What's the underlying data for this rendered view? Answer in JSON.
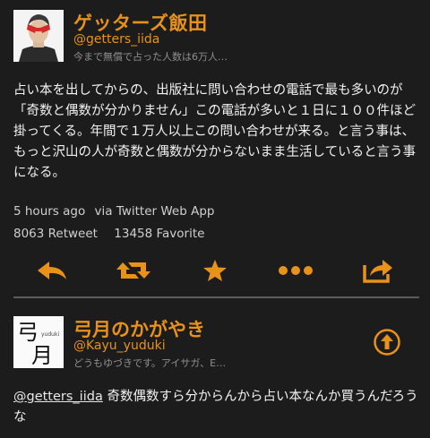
{
  "main_tweet": {
    "display_name": "ゲッターズ飯田",
    "handle": "@getters_iida",
    "bio_snippet": "今まで無償で占った人数は6万人…",
    "text": "占い本を出してからの、出版社に問い合わせの電話で最も多いのが「奇数と偶数が分かりません」この電話が多いと１日に１００件ほど掛ってくる。年間で１万人以上この問い合わせが来る。と言う事は、もっと沢山の人が奇数と偶数が分からないまま生活していると言う事になる。",
    "time": "5 hours ago",
    "via": "via Twitter Web App",
    "retweets": "8063 Retweet",
    "favorites": "13458 Favorite"
  },
  "actions": {
    "icons": [
      "reply-icon",
      "retweet-icon",
      "favorite-icon",
      "more-icon",
      "share-icon"
    ],
    "accent_color": "#e8921a"
  },
  "reply_tweet": {
    "display_name": "弓月のかがやき",
    "handle": "@Kayu_yuduki",
    "bio_snippet": "どうもゆづきです。アイサガ、E…",
    "mention": "@getters_iida",
    "text": " 奇数偶数すら分からんから占い本なんか買うんだろうな",
    "avatar_glyphs": "弓月",
    "avatar_caption": "yuduki"
  }
}
